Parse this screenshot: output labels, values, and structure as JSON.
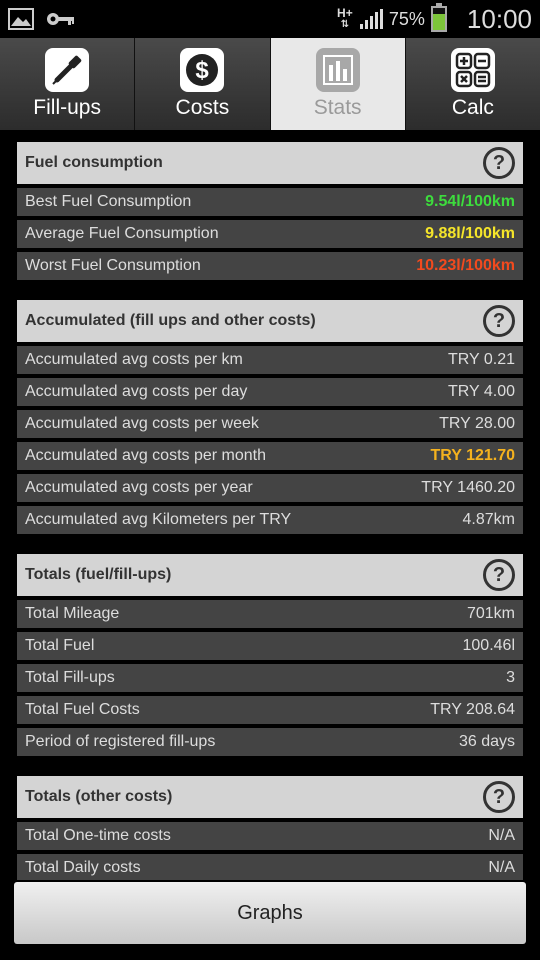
{
  "status_bar": {
    "network": "H+",
    "battery_percent": "75%",
    "battery_level": 0.75,
    "clock": "10:00",
    "left_icons": [
      "image-icon",
      "key-icon"
    ]
  },
  "tabs": [
    {
      "label": "Fill-ups",
      "icon": "fuel-pump-icon",
      "active": false
    },
    {
      "label": "Costs",
      "icon": "dollar-icon",
      "active": false
    },
    {
      "label": "Stats",
      "icon": "bar-chart-icon",
      "active": true
    },
    {
      "label": "Calc",
      "icon": "calculator-icon",
      "active": false
    }
  ],
  "colors": {
    "best": "#3ddc3d",
    "average": "#f5e52a",
    "worst": "#f24a1e",
    "highlight": "#f5b21e"
  },
  "sections": [
    {
      "title": "Fuel consumption",
      "rows": [
        {
          "label": "Best Fuel Consumption",
          "value": "9.54l/100km",
          "color": "#3ddc3d"
        },
        {
          "label": "Average Fuel Consumption",
          "value": "9.88l/100km",
          "color": "#f5e52a"
        },
        {
          "label": "Worst Fuel Consumption",
          "value": "10.23l/100km",
          "color": "#f24a1e"
        }
      ]
    },
    {
      "title": "Accumulated (fill ups and other costs)",
      "rows": [
        {
          "label": "Accumulated avg costs per km",
          "value": "TRY 0.21"
        },
        {
          "label": "Accumulated avg costs per day",
          "value": "TRY 4.00"
        },
        {
          "label": "Accumulated avg costs per week",
          "value": "TRY 28.00"
        },
        {
          "label": "Accumulated avg costs per month",
          "value": "TRY 121.70",
          "color": "#f5b21e"
        },
        {
          "label": "Accumulated avg costs per year",
          "value": "TRY 1460.20"
        },
        {
          "label": "Accumulated avg Kilometers per TRY",
          "value": "4.87km"
        }
      ]
    },
    {
      "title": "Totals (fuel/fill-ups)",
      "rows": [
        {
          "label": "Total Mileage",
          "value": "701km"
        },
        {
          "label": "Total Fuel",
          "value": "100.46l"
        },
        {
          "label": "Total Fill-ups",
          "value": "3"
        },
        {
          "label": "Total Fuel Costs",
          "value": "TRY 208.64"
        },
        {
          "label": "Period of registered fill-ups",
          "value": "36 days"
        }
      ]
    },
    {
      "title": "Totals (other costs)",
      "rows": [
        {
          "label": "Total One-time costs",
          "value": "N/A"
        },
        {
          "label": "Total Daily costs",
          "value": "N/A"
        }
      ]
    }
  ],
  "graphs_button": "Graphs"
}
